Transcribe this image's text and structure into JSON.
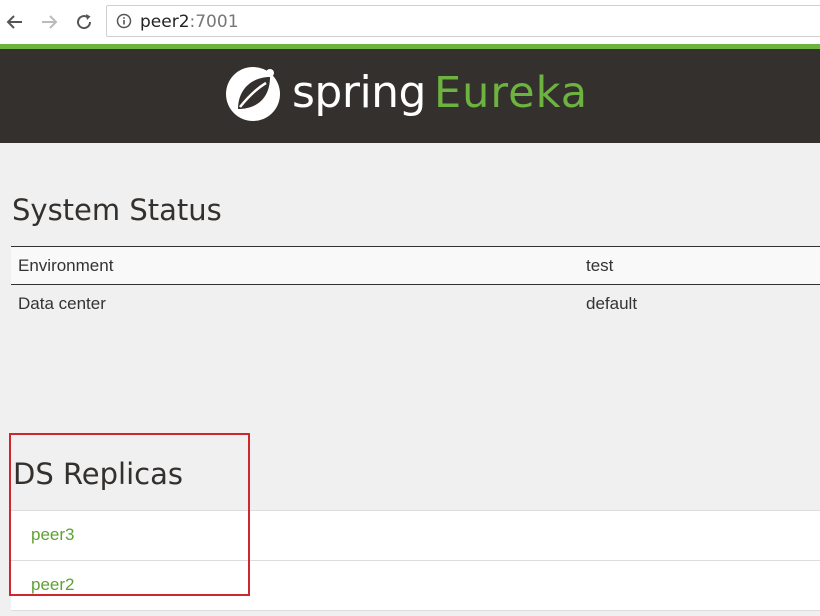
{
  "browser": {
    "url_host": "peer2",
    "url_port": ":7001",
    "icons": [
      "back-arrow-icon",
      "forward-arrow-icon",
      "reload-icon",
      "info-icon"
    ]
  },
  "header": {
    "logo_word_1": "spring",
    "logo_word_2": "Eureka",
    "background_color": "#34302d",
    "accent_color": "#6db33f"
  },
  "system_status": {
    "title": "System Status",
    "rows": [
      {
        "key": "Environment",
        "value": "test"
      },
      {
        "key": "Data center",
        "value": "default"
      }
    ]
  },
  "ds_replicas": {
    "title": "DS Replicas",
    "items": [
      "peer3",
      "peer2"
    ],
    "link_color": "#5fa134",
    "highlight_color": "#d0262d"
  }
}
